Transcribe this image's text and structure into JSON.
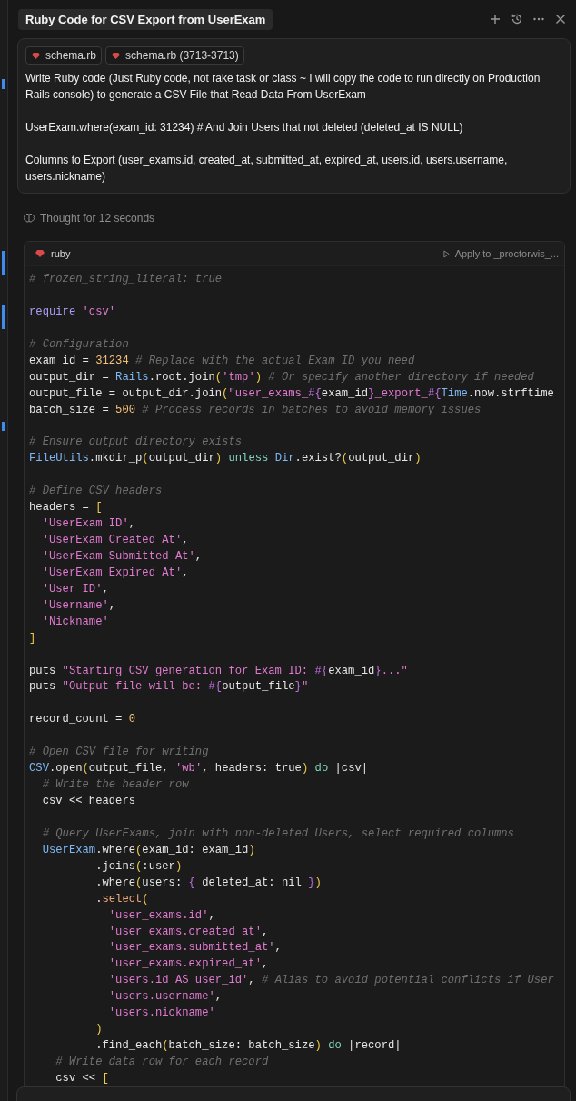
{
  "tab": {
    "title": "Ruby Code for CSV Export from UserExam",
    "selected": true
  },
  "prompt": {
    "attachments": [
      {
        "label": "schema.rb"
      },
      {
        "label": "schema.rb (3713-3713)"
      }
    ],
    "paragraphs": [
      "Write Ruby code (Just Ruby code, not rake task or class ~ I will copy the code to run directly on Production Rails console) to generate a CSV File that Read Data From UserExam",
      "UserExam.where(exam_id: 31234) # And Join Users that not deleted (deleted_at IS NULL)",
      "Columns to Export (user_exams.id, created_at, submitted_at, expired_at, users.id, users.username, users.nickname)"
    ]
  },
  "thought": "Thought for 12 seconds",
  "code_block": {
    "language": "ruby",
    "apply_label": "Apply to _proctorwis_...",
    "lines": [
      {
        "kind": "code",
        "tokens": [
          {
            "kind": "comment",
            "text": "# frozen_string_literal: true"
          }
        ]
      },
      {
        "kind": "blank"
      },
      {
        "kind": "code",
        "tokens": [
          {
            "kind": "keyword",
            "text": "require"
          },
          {
            "kind": "string",
            "text": " 'csv'"
          }
        ]
      },
      {
        "kind": "blank"
      },
      {
        "kind": "code",
        "tokens": [
          {
            "kind": "comment",
            "text": "# Configuration"
          }
        ]
      },
      {
        "kind": "code",
        "tokens": [
          {
            "kind": "plain",
            "text": "exam_id = "
          },
          {
            "kind": "number",
            "text": "31234"
          },
          {
            "kind": "comment",
            "text": " # Replace with the actual Exam ID you need"
          }
        ]
      },
      {
        "kind": "code",
        "tokens": [
          {
            "kind": "plain",
            "text": "output_dir = "
          },
          {
            "kind": "constant",
            "text": "Rails"
          },
          {
            "kind": "plain",
            "text": ".root.join"
          },
          {
            "kind": "bracket",
            "text": "("
          },
          {
            "kind": "string",
            "text": "'tmp'"
          },
          {
            "kind": "bracket",
            "text": ")"
          },
          {
            "kind": "comment",
            "text": " # Or specify another directory if needed"
          }
        ]
      },
      {
        "kind": "code",
        "tokens": [
          {
            "kind": "plain",
            "text": "output_file = output_dir.join"
          },
          {
            "kind": "bracket",
            "text": "("
          },
          {
            "kind": "string",
            "text": "\"user_exams_"
          },
          {
            "kind": "interp",
            "text": "#{"
          },
          {
            "kind": "plain",
            "text": "exam_id"
          },
          {
            "kind": "interp",
            "text": "}"
          },
          {
            "kind": "string",
            "text": "_export_"
          },
          {
            "kind": "interp",
            "text": "#{"
          },
          {
            "kind": "constant",
            "text": "Time"
          },
          {
            "kind": "plain",
            "text": ".now.strftime"
          }
        ]
      },
      {
        "kind": "code",
        "tokens": [
          {
            "kind": "plain",
            "text": "batch_size = "
          },
          {
            "kind": "number",
            "text": "500"
          },
          {
            "kind": "comment",
            "text": " # Process records in batches to avoid memory issues"
          }
        ]
      },
      {
        "kind": "blank"
      },
      {
        "kind": "code",
        "tokens": [
          {
            "kind": "comment",
            "text": "# Ensure output directory exists"
          }
        ]
      },
      {
        "kind": "code",
        "tokens": [
          {
            "kind": "constant",
            "text": "FileUtils"
          },
          {
            "kind": "plain",
            "text": ".mkdir_p"
          },
          {
            "kind": "bracket",
            "text": "("
          },
          {
            "kind": "plain",
            "text": "output_dir"
          },
          {
            "kind": "bracket",
            "text": ")"
          },
          {
            "kind": "control",
            "text": " unless "
          },
          {
            "kind": "constant",
            "text": "Dir"
          },
          {
            "kind": "plain",
            "text": ".exist?"
          },
          {
            "kind": "bracket",
            "text": "("
          },
          {
            "kind": "plain",
            "text": "output_dir"
          },
          {
            "kind": "bracket",
            "text": ")"
          }
        ]
      },
      {
        "kind": "blank"
      },
      {
        "kind": "code",
        "tokens": [
          {
            "kind": "comment",
            "text": "# Define CSV headers"
          }
        ]
      },
      {
        "kind": "code",
        "tokens": [
          {
            "kind": "plain",
            "text": "headers = "
          },
          {
            "kind": "bracket",
            "text": "["
          }
        ]
      },
      {
        "kind": "code",
        "tokens": [
          {
            "kind": "string",
            "text": "  'UserExam ID'"
          },
          {
            "kind": "plain",
            "text": ","
          }
        ]
      },
      {
        "kind": "code",
        "tokens": [
          {
            "kind": "string",
            "text": "  'UserExam Created At'"
          },
          {
            "kind": "plain",
            "text": ","
          }
        ]
      },
      {
        "kind": "code",
        "tokens": [
          {
            "kind": "string",
            "text": "  'UserExam Submitted At'"
          },
          {
            "kind": "plain",
            "text": ","
          }
        ]
      },
      {
        "kind": "code",
        "tokens": [
          {
            "kind": "string",
            "text": "  'UserExam Expired At'"
          },
          {
            "kind": "plain",
            "text": ","
          }
        ]
      },
      {
        "kind": "code",
        "tokens": [
          {
            "kind": "string",
            "text": "  'User ID'"
          },
          {
            "kind": "plain",
            "text": ","
          }
        ]
      },
      {
        "kind": "code",
        "tokens": [
          {
            "kind": "string",
            "text": "  'Username'"
          },
          {
            "kind": "plain",
            "text": ","
          }
        ]
      },
      {
        "kind": "code",
        "tokens": [
          {
            "kind": "string",
            "text": "  'Nickname'"
          }
        ]
      },
      {
        "kind": "code",
        "tokens": [
          {
            "kind": "bracket",
            "text": "]"
          }
        ]
      },
      {
        "kind": "blank"
      },
      {
        "kind": "code",
        "tokens": [
          {
            "kind": "plain",
            "text": "puts "
          },
          {
            "kind": "string",
            "text": "\"Starting CSV generation for Exam ID: "
          },
          {
            "kind": "interp",
            "text": "#{"
          },
          {
            "kind": "plain",
            "text": "exam_id"
          },
          {
            "kind": "interp",
            "text": "}"
          },
          {
            "kind": "string",
            "text": "...\""
          }
        ]
      },
      {
        "kind": "code",
        "tokens": [
          {
            "kind": "plain",
            "text": "puts "
          },
          {
            "kind": "string",
            "text": "\"Output file will be: "
          },
          {
            "kind": "interp",
            "text": "#{"
          },
          {
            "kind": "plain",
            "text": "output_file"
          },
          {
            "kind": "interp",
            "text": "}"
          },
          {
            "kind": "string",
            "text": "\""
          }
        ]
      },
      {
        "kind": "blank"
      },
      {
        "kind": "code",
        "tokens": [
          {
            "kind": "plain",
            "text": "record_count = "
          },
          {
            "kind": "number",
            "text": "0"
          }
        ]
      },
      {
        "kind": "blank"
      },
      {
        "kind": "code",
        "tokens": [
          {
            "kind": "comment",
            "text": "# Open CSV file for writing"
          }
        ]
      },
      {
        "kind": "code",
        "tokens": [
          {
            "kind": "constant",
            "text": "CSV"
          },
          {
            "kind": "plain",
            "text": ".open"
          },
          {
            "kind": "bracket",
            "text": "("
          },
          {
            "kind": "plain",
            "text": "output_file, "
          },
          {
            "kind": "string",
            "text": "'wb'"
          },
          {
            "kind": "plain",
            "text": ", headers: true"
          },
          {
            "kind": "bracket",
            "text": ")"
          },
          {
            "kind": "control",
            "text": " do"
          },
          {
            "kind": "plain",
            "text": " |csv|"
          }
        ]
      },
      {
        "kind": "code",
        "tokens": [
          {
            "kind": "comment",
            "text": "  # Write the header row"
          }
        ]
      },
      {
        "kind": "code",
        "tokens": [
          {
            "kind": "plain",
            "text": "  csv << headers"
          }
        ]
      },
      {
        "kind": "blank"
      },
      {
        "kind": "code",
        "tokens": [
          {
            "kind": "comment",
            "text": "  # Query UserExams, join with non-deleted Users, select required columns"
          }
        ]
      },
      {
        "kind": "code",
        "tokens": [
          {
            "kind": "constant",
            "text": "  UserExam"
          },
          {
            "kind": "plain",
            "text": ".where"
          },
          {
            "kind": "bracket",
            "text": "("
          },
          {
            "kind": "plain",
            "text": "exam_id: exam_id"
          },
          {
            "kind": "bracket",
            "text": ")"
          }
        ]
      },
      {
        "kind": "code",
        "tokens": [
          {
            "kind": "plain",
            "text": "          .joins"
          },
          {
            "kind": "bracket",
            "text": "("
          },
          {
            "kind": "plain",
            "text": ":user"
          },
          {
            "kind": "bracket",
            "text": ")"
          }
        ]
      },
      {
        "kind": "code",
        "tokens": [
          {
            "kind": "plain",
            "text": "          .where"
          },
          {
            "kind": "bracket",
            "text": "("
          },
          {
            "kind": "plain",
            "text": "users: "
          },
          {
            "kind": "interp",
            "text": "{"
          },
          {
            "kind": "plain",
            "text": " deleted_at: nil "
          },
          {
            "kind": "interp",
            "text": "}"
          },
          {
            "kind": "bracket",
            "text": ")"
          }
        ]
      },
      {
        "kind": "code",
        "tokens": [
          {
            "kind": "plain",
            "text": "          ."
          },
          {
            "kind": "method",
            "text": "select"
          },
          {
            "kind": "bracket",
            "text": "("
          }
        ]
      },
      {
        "kind": "code",
        "tokens": [
          {
            "kind": "string",
            "text": "            'user_exams.id'"
          },
          {
            "kind": "plain",
            "text": ","
          }
        ]
      },
      {
        "kind": "code",
        "tokens": [
          {
            "kind": "string",
            "text": "            'user_exams.created_at'"
          },
          {
            "kind": "plain",
            "text": ","
          }
        ]
      },
      {
        "kind": "code",
        "tokens": [
          {
            "kind": "string",
            "text": "            'user_exams.submitted_at'"
          },
          {
            "kind": "plain",
            "text": ","
          }
        ]
      },
      {
        "kind": "code",
        "tokens": [
          {
            "kind": "string",
            "text": "            'user_exams.expired_at'"
          },
          {
            "kind": "plain",
            "text": ","
          }
        ]
      },
      {
        "kind": "code",
        "tokens": [
          {
            "kind": "string",
            "text": "            'users.id AS user_id'"
          },
          {
            "kind": "plain",
            "text": ","
          },
          {
            "kind": "comment",
            "text": " # Alias to avoid potential conflicts if User"
          }
        ]
      },
      {
        "kind": "code",
        "tokens": [
          {
            "kind": "string",
            "text": "            'users.username'"
          },
          {
            "kind": "plain",
            "text": ","
          }
        ]
      },
      {
        "kind": "code",
        "tokens": [
          {
            "kind": "string",
            "text": "            'users.nickname'"
          }
        ]
      },
      {
        "kind": "code",
        "tokens": [
          {
            "kind": "bracket",
            "text": "          )"
          }
        ]
      },
      {
        "kind": "code",
        "tokens": [
          {
            "kind": "plain",
            "text": "          .find_each"
          },
          {
            "kind": "bracket",
            "text": "("
          },
          {
            "kind": "plain",
            "text": "batch_size: batch_size"
          },
          {
            "kind": "bracket",
            "text": ")"
          },
          {
            "kind": "control",
            "text": " do"
          },
          {
            "kind": "plain",
            "text": " |record|"
          }
        ]
      },
      {
        "kind": "code",
        "tokens": [
          {
            "kind": "comment",
            "text": "    # Write data row for each record"
          }
        ]
      },
      {
        "kind": "code",
        "tokens": [
          {
            "kind": "plain",
            "text": "    csv << "
          },
          {
            "kind": "bracket",
            "text": "["
          }
        ]
      }
    ]
  }
}
